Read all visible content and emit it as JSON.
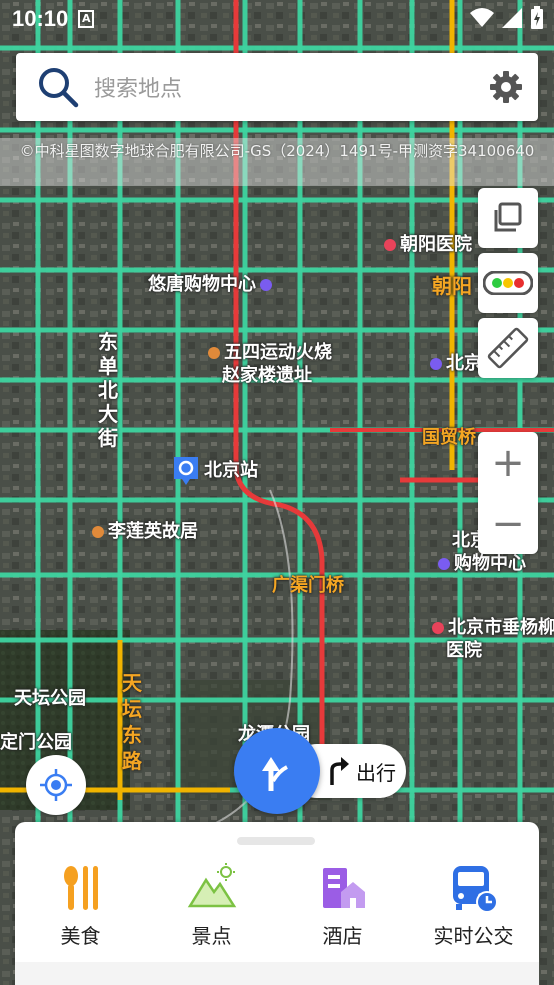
{
  "status_bar": {
    "time": "10:10",
    "notification": "A"
  },
  "search": {
    "placeholder": "搜索地点"
  },
  "attribution": "©中科星图数字地球合肥有限公司-GS（2024）1491号-甲测资字34100640",
  "map_labels": [
    {
      "text": "朝阳医院",
      "color": "white",
      "poi": "hospital"
    },
    {
      "text": "朝阳",
      "color": "orange",
      "poi": ""
    },
    {
      "text": "悠唐购物中心",
      "color": "white",
      "poi": "mall"
    },
    {
      "text": "北京",
      "color": "white",
      "poi": "mall"
    },
    {
      "text": "五四运动火烧",
      "color": "white",
      "poi": "landmark"
    },
    {
      "text": "赵家楼遗址",
      "color": "white",
      "poi": ""
    },
    {
      "text": "国贸桥",
      "color": "orange",
      "poi": ""
    },
    {
      "text": "北京站",
      "color": "white",
      "poi": "station"
    },
    {
      "text": "李莲英故居",
      "color": "white",
      "poi": "landmark"
    },
    {
      "text": "北京",
      "color": "white",
      "poi": ""
    },
    {
      "text": "购物中心",
      "color": "white",
      "poi": "mall"
    },
    {
      "text": "广渠门桥",
      "color": "orange",
      "poi": ""
    },
    {
      "text": "北京市垂杨柳",
      "color": "white",
      "poi": "hospital"
    },
    {
      "text": "医院",
      "color": "white",
      "poi": ""
    },
    {
      "text": "天坛公园",
      "color": "white",
      "poi": ""
    },
    {
      "text": "定门公园",
      "color": "white",
      "poi": ""
    },
    {
      "text": "龙潭公园",
      "color": "white",
      "poi": ""
    },
    {
      "text": "东单北大街",
      "color": "white",
      "poi": ""
    },
    {
      "text": "天坛东路",
      "color": "orange",
      "poi": ""
    }
  ],
  "controls": {
    "layers": "layers-icon",
    "traffic": "traffic-light-icon",
    "ruler": "ruler-icon",
    "zoom_in": "+",
    "zoom_out": "−"
  },
  "route_button": {
    "label": "出行"
  },
  "categories": [
    {
      "label": "美食",
      "icon": "food-icon",
      "color": "#f5a020"
    },
    {
      "label": "景点",
      "icon": "scenic-icon",
      "color": "#7cc243"
    },
    {
      "label": "酒店",
      "icon": "hotel-icon",
      "color": "#9b5de5"
    },
    {
      "label": "实时公交",
      "icon": "bus-icon",
      "color": "#2f6fe4"
    }
  ]
}
